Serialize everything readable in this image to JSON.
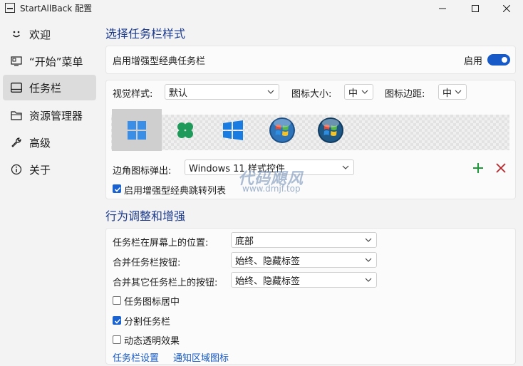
{
  "window": {
    "title": "StartAllBack 配置"
  },
  "sidebar": {
    "items": [
      {
        "label": "欢迎",
        "icon": "smile-icon",
        "active": false
      },
      {
        "label": "“开始”菜单",
        "icon": "start-menu-icon",
        "active": false
      },
      {
        "label": "任务栏",
        "icon": "taskbar-icon",
        "active": true
      },
      {
        "label": "资源管理器",
        "icon": "folder-icon",
        "active": false
      },
      {
        "label": "高级",
        "icon": "wrench-icon",
        "active": false
      },
      {
        "label": "关于",
        "icon": "info-icon",
        "active": false
      }
    ]
  },
  "taskbar_style": {
    "heading": "选择任务栏样式",
    "enhanced_label": "启用增强型经典任务栏",
    "toggle_label": "启用",
    "toggle_on": true,
    "visual_style_label": "视觉样式:",
    "visual_style_value": "默认",
    "icon_size_label": "图标大小:",
    "icon_size_value": "中",
    "icon_margin_label": "图标边距:",
    "icon_margin_value": "中",
    "style_options": [
      "windows11-logo-icon",
      "clover-logo-icon",
      "windows10-logo-icon",
      "windows7-orb-icon",
      "windows-vista-orb-icon"
    ],
    "selected_style_index": 0,
    "corner_popup_label": "边角图标弹出:",
    "corner_popup_value": "Windows 11 样式控件",
    "jumplist_label": "启用增强型经典跳转列表",
    "jumplist_checked": true
  },
  "behavior": {
    "heading": "行为调整和增强",
    "position_label": "任务栏在屏幕上的位置:",
    "position_value": "底部",
    "combine_label": "合并任务栏按钮:",
    "combine_value": "始终、隐藏标签",
    "combine_other_label": "合并其它任务栏上的按钮:",
    "combine_other_value": "始终、隐藏标签",
    "center_icons_label": "任务图标居中",
    "center_icons_checked": false,
    "split_label": "分割任务栏",
    "split_checked": true,
    "dynamic_label": "动态透明效果",
    "dynamic_checked": false
  },
  "links": {
    "taskbar_settings": "任务栏设置",
    "notification_icons": "通知区域图标"
  },
  "watermark": {
    "line1": "代码飓风",
    "line2": "www.dmjf.top"
  },
  "colors": {
    "accent": "#1659c7",
    "heading": "#1b3a8c",
    "add_green": "#1f9a3a",
    "remove_red": "#b8262a"
  }
}
